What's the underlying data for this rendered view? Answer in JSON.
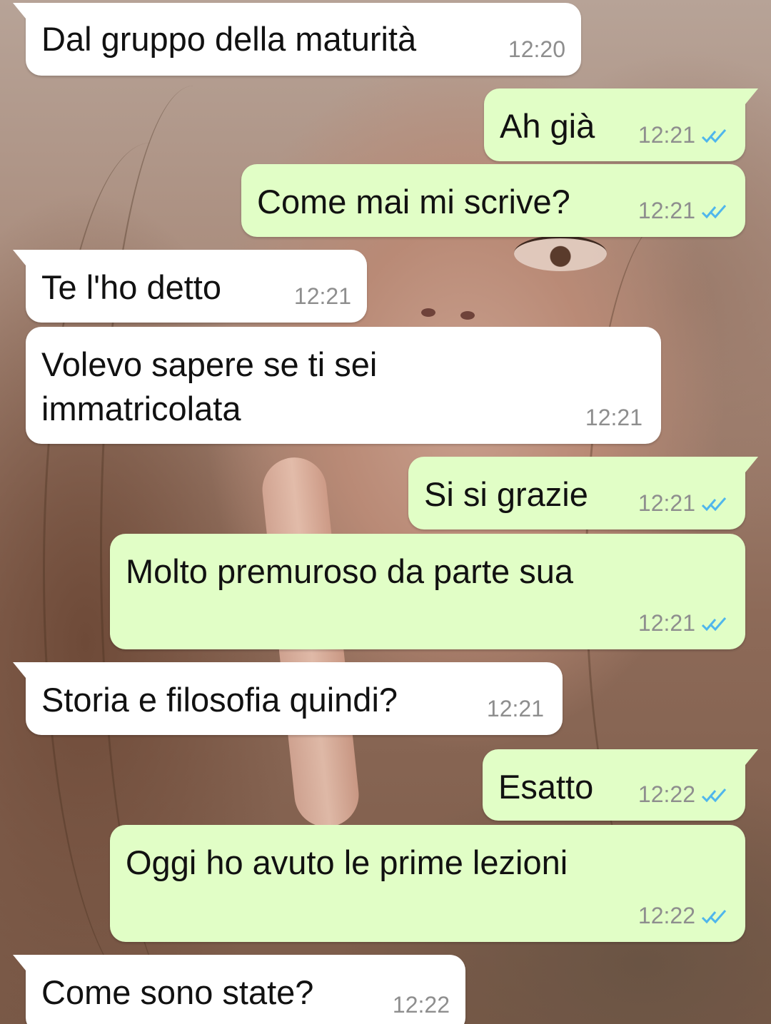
{
  "colors": {
    "incoming_bubble": "#ffffff",
    "outgoing_bubble": "#e1fec6",
    "timestamp": "#8e8e8e",
    "read_ticks": "#4fb6ec"
  },
  "wallpaper": {
    "description_icon": "photo-wallpaper"
  },
  "messages": [
    {
      "dir": "in",
      "text": "Dal gruppo della maturità",
      "time": "12:20"
    },
    {
      "dir": "out",
      "text": "Ah già",
      "time": "12:21",
      "status": "read"
    },
    {
      "dir": "out",
      "text": "Come mai mi scrive?",
      "time": "12:21",
      "status": "read"
    },
    {
      "dir": "in",
      "text": "Te l'ho detto",
      "time": "12:21"
    },
    {
      "dir": "in",
      "text": "Volevo sapere se ti sei\nimmatricolata",
      "time": "12:21"
    },
    {
      "dir": "out",
      "text": "Si si grazie",
      "time": "12:21",
      "status": "read"
    },
    {
      "dir": "out",
      "text": "Molto premuroso da parte sua",
      "time": "12:21",
      "status": "read"
    },
    {
      "dir": "in",
      "text": "Storia e filosofia quindi?",
      "time": "12:21"
    },
    {
      "dir": "out",
      "text": "Esatto",
      "time": "12:22",
      "status": "read"
    },
    {
      "dir": "out",
      "text": "Oggi ho avuto le prime lezioni",
      "time": "12:22",
      "status": "read"
    },
    {
      "dir": "in",
      "text": "Come sono state?",
      "time": "12:22"
    }
  ]
}
